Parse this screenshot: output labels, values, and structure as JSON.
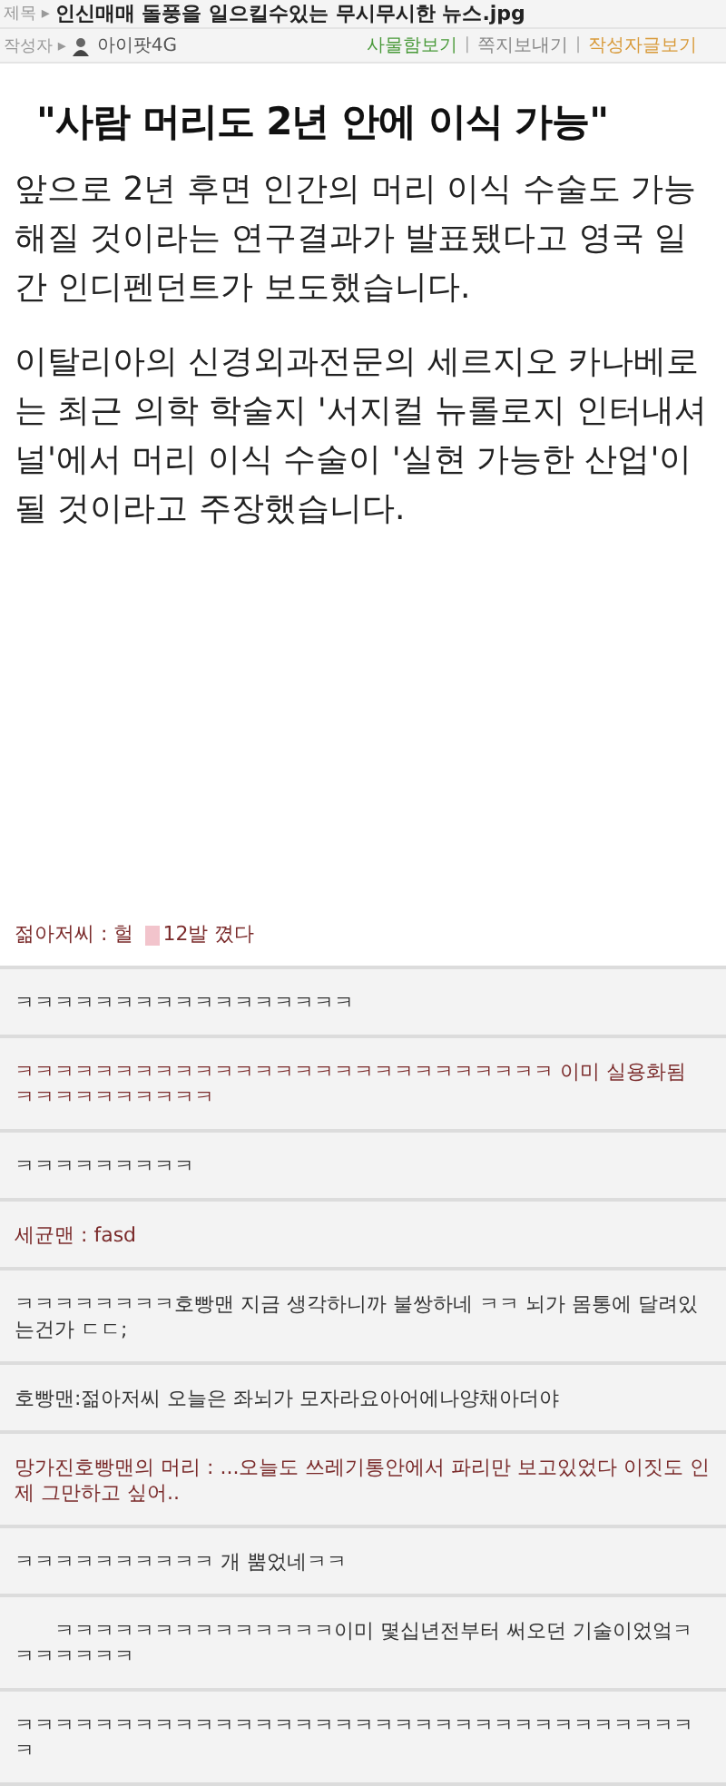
{
  "post": {
    "title_label": "제목 ▸",
    "title": "인신매매 돌풍을 일으킬수있는 무시무시한 뉴스.jpg",
    "author_label": "작성자 ▸",
    "author": "아이팟4G",
    "links": [
      {
        "label": "사물함보기",
        "color": "#4a9a3a"
      },
      {
        "label": "쪽지보내기",
        "color": "#888888"
      },
      {
        "label": "작성자글보기",
        "color": "#d89a3a"
      }
    ],
    "separator": "|"
  },
  "article": {
    "headline": "\"사람 머리도 2년 안에 이식 가능\"",
    "paragraphs": [
      "앞으로 2년 후면 인간의 머리 이식 수술도 가능해질 것이라는 연구결과가 발표됐다고 영국 일간 인디펜던트가 보도했습니다.",
      "이탈리아의 신경외과전문의 세르지오 카나베로는 최근 의학 학술지 '서지컬 뉴롤로지 인터내셔널'에서 머리 이식 수술이 '실현 가능한 산업'이 될 것이라고 주장했습니다."
    ]
  },
  "comments": [
    {
      "text": "젊아저씨 : 헐",
      "censored": true,
      "text_after": "12발 꼈다",
      "color": "#7a2a2a",
      "indented": false
    },
    {
      "text": "ㅋㅋㅋㅋㅋㅋㅋㅋㅋㅋㅋㅋㅋㅋㅋㅋㅋ",
      "color": "#333333",
      "indented": false
    },
    {
      "text": "ㅋㅋㅋㅋㅋㅋㅋㅋㅋㅋㅋㅋㅋㅋㅋㅋㅋㅋㅋㅋㅋㅋㅋㅋㅋㅋㅋ 이미 실용화됨 ㅋㅋㅋㅋㅋㅋㅋㅋㅋㅋ",
      "color": "#7a2a2a",
      "indented": false
    },
    {
      "text": "ㅋㅋㅋㅋㅋㅋㅋㅋㅋ",
      "color": "#333333",
      "indented": false
    },
    {
      "text": "세균맨 : fasd",
      "color": "#7a2a2a",
      "indented": false
    },
    {
      "text": "ㅋㅋㅋㅋㅋㅋㅋㅋ호빵맨 지금 생각하니까 불쌍하네 ㅋㅋ 뇌가 몸통에 달려있는건가 ㄷㄷ;",
      "color": "#333333",
      "indented": false
    },
    {
      "text": "호빵맨:젊아저씨 오늘은 좌뇌가 모자라요아어에나양채아더야",
      "color": "#333333",
      "indented": false
    },
    {
      "text": "망가진호빵맨의 머리 : ...오늘도 쓰레기통안에서 파리만 보고있었다 이짓도 인제 그만하고 싶어..",
      "color": "#7a2a2a",
      "indented": false
    },
    {
      "text": "ㅋㅋㅋㅋㅋㅋㅋㅋㅋㅋ 개 뿜었네ㅋㅋ",
      "color": "#333333",
      "indented": false
    },
    {
      "text": "ㅋㅋㅋㅋㅋㅋㅋㅋㅋㅋㅋㅋㅋㅋ이미 몇십년전부터 써오던 기술이었엌ㅋㅋㅋㅋㅋㅋㅋ",
      "color": "#333333",
      "indented": true
    },
    {
      "text": "ㅋㅋㅋㅋㅋㅋㅋㅋㅋㅋㅋㅋㅋㅋㅋㅋㅋㅋㅋㅋㅋㅋㅋㅋㅋㅋㅋㅋㅋㅋㅋㅋㅋㅋㅋ",
      "color": "#333333",
      "indented": false
    }
  ]
}
